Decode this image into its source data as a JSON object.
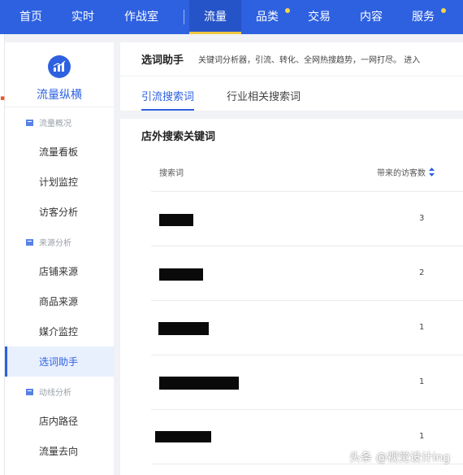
{
  "topnav": {
    "items": [
      {
        "label": "首页"
      },
      {
        "label": "实时"
      },
      {
        "label": "作战室"
      },
      {
        "label": "流量"
      },
      {
        "label": "品类"
      },
      {
        "label": "交易"
      },
      {
        "label": "内容"
      },
      {
        "label": "服务"
      }
    ]
  },
  "sidebar": {
    "brand": "流量纵横",
    "groups": [
      {
        "label": "流量概况",
        "items": [
          "流量看板",
          "计划监控",
          "访客分析"
        ]
      },
      {
        "label": "来源分析",
        "items": [
          "店铺来源",
          "商品来源",
          "媒介监控",
          "选词助手"
        ]
      },
      {
        "label": "动线分析",
        "items": [
          "店内路径",
          "流量去向"
        ]
      }
    ]
  },
  "main": {
    "title": "选词助手",
    "description": "关键词分析器，引流、转化、全网热搜趋势，一网打尽。 进入",
    "tabs": [
      {
        "label": "引流搜索词"
      },
      {
        "label": "行业相关搜索词"
      }
    ],
    "table": {
      "title": "店外搜索关键词",
      "columns": {
        "term": "搜索词",
        "visitors": "带来的访客数"
      },
      "rows": [
        {
          "visitors": "3"
        },
        {
          "visitors": "2"
        },
        {
          "visitors": "1"
        },
        {
          "visitors": "1"
        },
        {
          "visitors": "1"
        }
      ]
    }
  },
  "watermark": "头条 @视觉设计ing",
  "colors": {
    "primary": "#2e61e0",
    "nav_active_underline": "#f5c542",
    "nav_dot": "#f5d54a",
    "redaction": "#0a0a0a"
  }
}
